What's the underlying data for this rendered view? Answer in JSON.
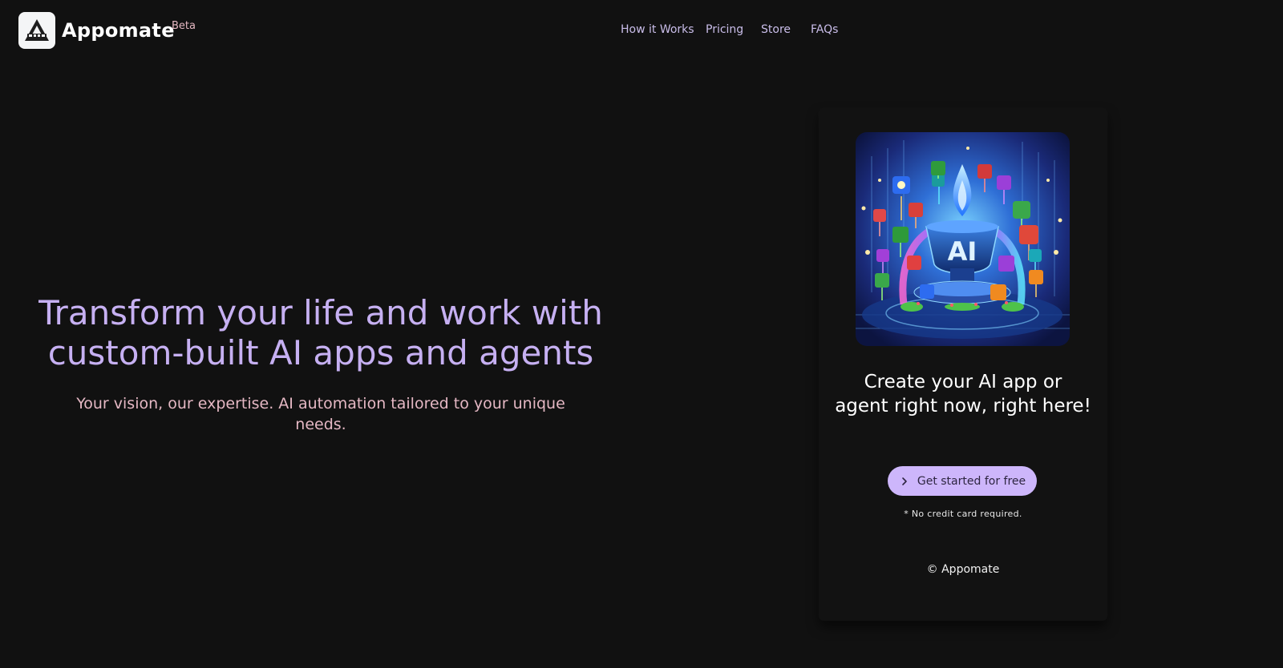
{
  "header": {
    "brand_name": "Appomate",
    "beta_badge": "Beta",
    "logo_icon": "appomate-logo-icon"
  },
  "nav": {
    "items": [
      {
        "label": "How it Works"
      },
      {
        "label": "Pricing"
      },
      {
        "label": "Store"
      },
      {
        "label": "FAQs"
      }
    ]
  },
  "hero": {
    "title": "Transform your life and work with custom-built AI apps and agents",
    "subtitle": "Your vision, our expertise. AI automation tailored to your unique needs."
  },
  "card": {
    "image_label": "AI",
    "heading": "Create your AI app or agent right now, right here!",
    "cta_label": "Get started for free",
    "cta_icon": "chevron-right-icon",
    "note": "* No credit card required.",
    "copyright": "© Appomate"
  },
  "colors": {
    "background": "#111111",
    "hero_title": "#c6b0f2",
    "hero_subtitle": "#e5b8c4",
    "nav_link": "#c9bde9",
    "beta": "#e5b8c2",
    "cta_bg": "#cdb6fb"
  }
}
